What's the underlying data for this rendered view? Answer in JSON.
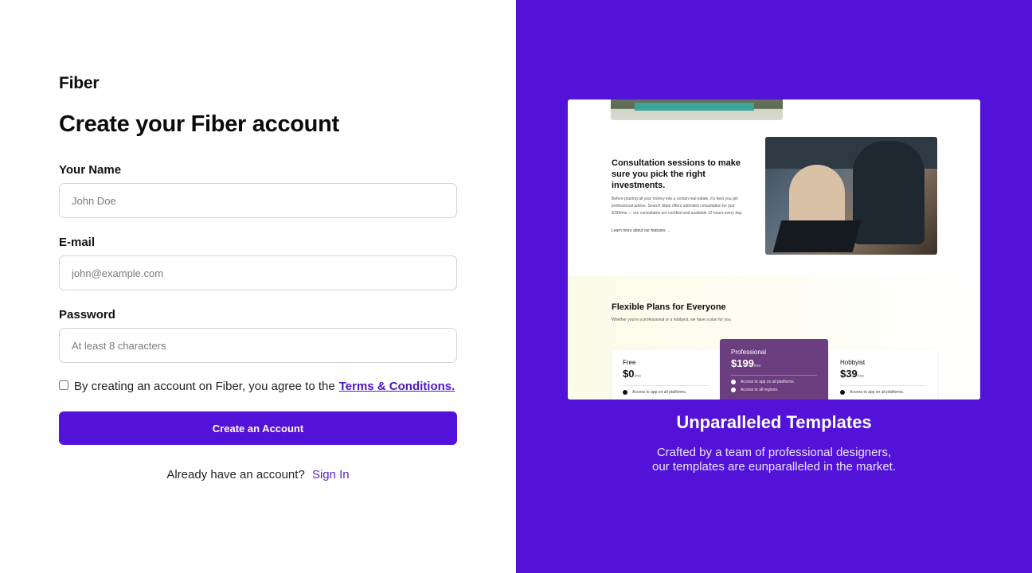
{
  "app": {
    "brand": "Fiber",
    "accent": "#5212d8"
  },
  "form": {
    "title": "Create your Fiber account",
    "name_label": "Your Name",
    "name_placeholder": "John Doe",
    "email_label": "E-mail",
    "email_placeholder": "john@example.com",
    "password_label": "Password",
    "password_placeholder": "At least 8 characters",
    "agree_text": "By creating an account on Fiber, you agree to the",
    "terms_link": "Terms & Conditions.",
    "submit_label": "Create an Account",
    "signin_prompt": "Already have an account?",
    "signin_link": "Sign In"
  },
  "preview": {
    "consult_title": "Consultation sessions to make sure you pick the right investments.",
    "consult_body": "Before pouring all your money into a certain real estate, it's best you get professional advice. Search State offers unlimited consultation for just $199/mo — our consultants are certified and available 12 hours every day.",
    "consult_link": "Learn more about our features →",
    "plans_title": "Flexible Plans for Everyone",
    "plans_sub": "Whether you're a professional or a hobbyist, we have a plan for you.",
    "plans": [
      {
        "name": "Free",
        "price": "$0",
        "period": "/mo",
        "feature_1": "Access to app on all platforms."
      },
      {
        "name": "Professional",
        "price": "$199",
        "period": "/mo",
        "feature_1": "Access to app on all platforms.",
        "feature_2": "Access to all regions."
      },
      {
        "name": "Hobbyist",
        "price": "$39",
        "period": "/mo",
        "feature_1": "Access to app on all platforms."
      }
    ]
  },
  "showcase": {
    "title": "Unparalleled Templates",
    "line_1": "Crafted by a team of professional designers,",
    "line_2": "our templates are eunparalleled in the market."
  }
}
